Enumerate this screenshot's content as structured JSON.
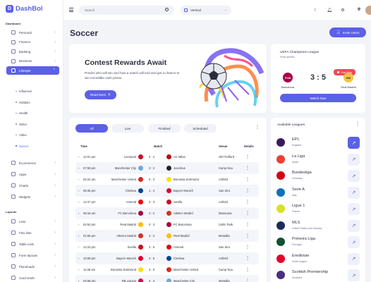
{
  "brand": {
    "name": "DashBol",
    "mark": "D"
  },
  "sidebar": {
    "section_dashboard": "Dashboard",
    "items": [
      {
        "label": "Personal",
        "icon": "user-icon"
      },
      {
        "label": "Finance",
        "icon": "finance-icon"
      },
      {
        "label": "Banking",
        "icon": "bank-icon"
      },
      {
        "label": "Business",
        "icon": "briefcase-icon"
      },
      {
        "label": "Lifestyle",
        "icon": "heart-icon",
        "active": true
      }
    ],
    "lifestyle_sub": [
      "Influencer",
      "Hobbies",
      "Health",
      "Writer",
      "Video",
      "Soccer"
    ],
    "more_items": [
      {
        "label": "Ecommerce",
        "icon": "cart-icon"
      },
      {
        "label": "Apps",
        "icon": "apps-icon"
      },
      {
        "label": "Charts",
        "icon": "chart-icon"
      },
      {
        "label": "Widgets",
        "icon": "widget-icon"
      }
    ],
    "section_layouts": "Layouts",
    "layout_items": [
      {
        "label": "Lists",
        "icon": "list-icon"
      },
      {
        "label": "Flex lists",
        "icon": "flex-icon"
      },
      {
        "label": "Table Lists",
        "icon": "table-icon"
      },
      {
        "label": "Form layouts",
        "icon": "form-icon"
      },
      {
        "label": "Placeloads",
        "icon": "loader-icon"
      },
      {
        "label": "Card Grids",
        "icon": "grid-icon"
      }
    ]
  },
  "topbar": {
    "search_placeholder": "Search",
    "layout_value": "Vertical"
  },
  "page": {
    "title": "Soccer",
    "invite_label": "Invite Users"
  },
  "hero": {
    "title": "Contest Rewards Await",
    "description": "Predict who will win and how a match will end and get a chance to win incredible cash prizes.",
    "button": "Read More"
  },
  "ucl": {
    "title": "UEFA Champions League",
    "stage": "Final stretch",
    "live_label": "Live Now",
    "home": "Barcelona",
    "away": "Real Madrid",
    "score": "3 : 5",
    "button": "Watch Now"
  },
  "filters": [
    "All",
    "Live",
    "Finished",
    "Scheduled"
  ],
  "table": {
    "headers": [
      "Time",
      "Match",
      "Venue",
      "Details"
    ],
    "rows": [
      {
        "time": "12:01 pm",
        "home": "Liverpool",
        "score": "3 : 2",
        "away": "AC Milan",
        "venue": "Old Trafford",
        "hc": "#c8102e",
        "ac": "#b80b17"
      },
      {
        "time": "07:59 pm",
        "home": "Manchester City",
        "score": "3 : 2",
        "away": "Juventus",
        "venue": "Camp Nou",
        "hc": "#6cabdd",
        "ac": "#222222"
      },
      {
        "time": "02:24 am",
        "home": "Manchester United",
        "score": "0 : 2",
        "away": "Borussia Dortmund",
        "venue": "Anfield",
        "hc": "#da291c",
        "ac": "#fde100"
      },
      {
        "time": "05:45 pm",
        "home": "Chelsea",
        "score": "1 : 4",
        "away": "Bayern Munich",
        "venue": "San Siro",
        "hc": "#034694",
        "ac": "#dc052d"
      },
      {
        "time": "12:47 pm",
        "home": "Arsenal",
        "score": "3 : 3",
        "away": "Sevilla",
        "venue": "Anfield",
        "hc": "#ef0107",
        "ac": "#d4021d"
      },
      {
        "time": "06:16 am",
        "home": "FC Barcelona",
        "score": "4 : 2",
        "away": "Atletico Madrid",
        "venue": "Maracana",
        "hc": "#a50044",
        "ac": "#cb3524"
      },
      {
        "time": "02:52 pm",
        "home": "Real Madrid",
        "score": "0 : 3",
        "away": "FC Barcelona",
        "venue": "Celtic Park",
        "hc": "#febe10",
        "ac": "#a50044"
      },
      {
        "time": "01:55 pm",
        "home": "Atletico Madrid",
        "score": "3 : 2",
        "away": "Real Madrid",
        "venue": "Mestalla",
        "hc": "#cb3524",
        "ac": "#febe10"
      },
      {
        "time": "12:23 pm",
        "home": "Sevilla",
        "score": "3 : 5",
        "away": "Arsenal",
        "venue": "San Siro",
        "hc": "#d4021d",
        "ac": "#ef0107"
      },
      {
        "time": "10:08 pm",
        "home": "Bayern Munich",
        "score": "2 : 5",
        "away": "Chelsea",
        "venue": "Anfield",
        "hc": "#dc052d",
        "ac": "#034694"
      },
      {
        "time": "11:38 am",
        "home": "Borussia Dortmund",
        "score": "3 : 0",
        "away": "Manchester United",
        "venue": "Camp Nou",
        "hc": "#fde100",
        "ac": "#da291c"
      },
      {
        "time": "04:58 pm",
        "home": "RB Leipzig",
        "score": "4 : 4",
        "away": "Manchester City",
        "venue": "Mestalla",
        "hc": "#dd0741",
        "ac": "#6cabdd"
      }
    ]
  },
  "leagues": {
    "title": "Available Leagues",
    "items": [
      {
        "name": "EPL",
        "country": "England",
        "color": "#3d195b",
        "abbr": "PL"
      },
      {
        "name": "La Liga",
        "country": "Spain",
        "color": "#ee3e2f",
        "abbr": "LL"
      },
      {
        "name": "Bundesliga",
        "country": "Germany",
        "color": "#d20515",
        "abbr": "BL"
      },
      {
        "name": "Serie A",
        "country": "Italy",
        "color": "#0a73b8",
        "abbr": "SA"
      },
      {
        "name": "Ligue 1",
        "country": "France",
        "color": "#dae025",
        "abbr": "L1"
      },
      {
        "name": "MLS",
        "country": "United States and Canada",
        "color": "#1b2b5a",
        "abbr": "MLS"
      },
      {
        "name": "Primeira Liga",
        "country": "Portugal",
        "color": "#0f5132",
        "abbr": "PL"
      },
      {
        "name": "Eredivisie",
        "country": "Dutch league",
        "color": "#e4002b",
        "abbr": "ED"
      },
      {
        "name": "Scottish Premiership",
        "country": "Scotland",
        "color": "#4b2d7f",
        "abbr": "SP"
      }
    ]
  },
  "colors": {
    "accent": "#5b60e8",
    "live": "#f04a5a",
    "page_bg": "#f3f4f8"
  }
}
